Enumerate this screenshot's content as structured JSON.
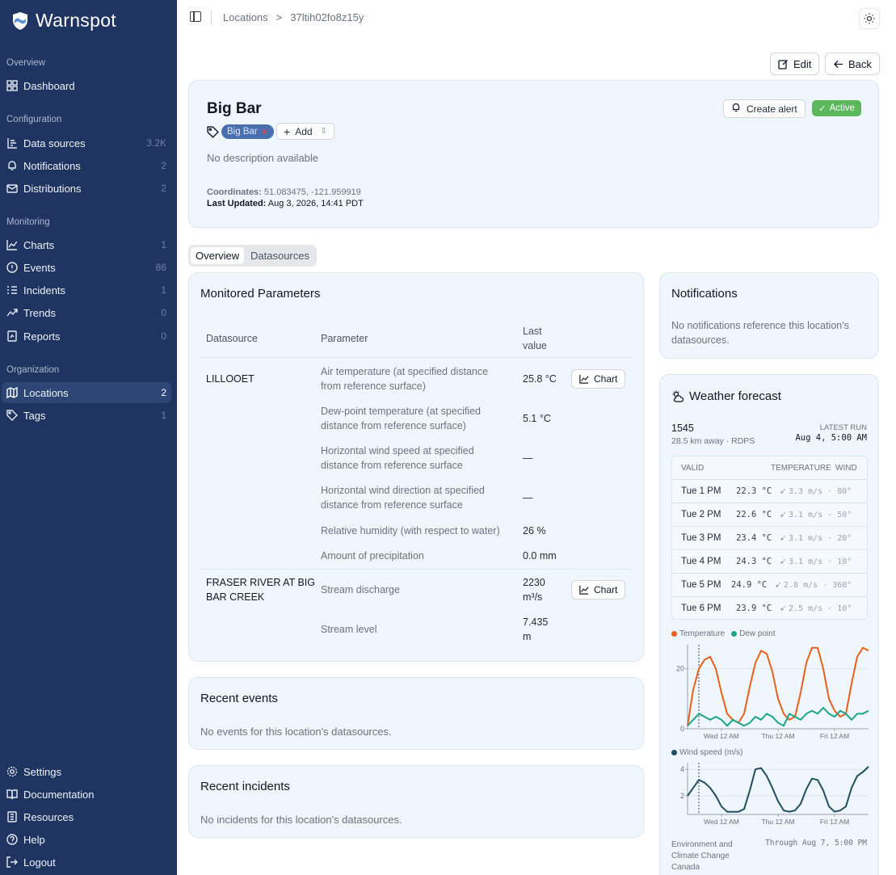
{
  "brand": {
    "name": "Warnspot"
  },
  "sidebar": {
    "sections": [
      {
        "label": "Overview"
      },
      {
        "label": "Configuration"
      },
      {
        "label": "Monitoring"
      },
      {
        "label": "Organization"
      }
    ],
    "items": [
      {
        "label": "Dashboard",
        "count": ""
      },
      {
        "label": "Data sources",
        "count": "3.2K"
      },
      {
        "label": "Notifications",
        "count": "2"
      },
      {
        "label": "Distributions",
        "count": "2"
      },
      {
        "label": "Charts",
        "count": "1"
      },
      {
        "label": "Events",
        "count": "86"
      },
      {
        "label": "Incidents",
        "count": "1"
      },
      {
        "label": "Trends",
        "count": "0"
      },
      {
        "label": "Reports",
        "count": "0"
      },
      {
        "label": "Locations",
        "count": "2"
      },
      {
        "label": "Tags",
        "count": "1"
      }
    ],
    "footer": [
      {
        "label": "Settings"
      },
      {
        "label": "Documentation"
      },
      {
        "label": "Resources"
      },
      {
        "label": "Help"
      },
      {
        "label": "Logout"
      }
    ]
  },
  "breadcrumb": {
    "parent": "Locations",
    "separator": ">",
    "current": "37ltih02fo8z15y"
  },
  "actions": {
    "edit": "Edit",
    "back": "Back"
  },
  "location": {
    "name": "Big Bar",
    "tag": "Big Bar",
    "add_label": "Add",
    "create_alert": "Create alert",
    "status": "Active",
    "description": "No description available",
    "coords_label": "Coordinates:",
    "coords_value": "51.083475, -121.959919",
    "updated_label": "Last Updated:",
    "updated_value": "Aug 3, 2026, 14:41 PDT"
  },
  "tabs": {
    "overview": "Overview",
    "datasources": "Datasources"
  },
  "monitored": {
    "title": "Monitored Parameters",
    "headers": {
      "datasource": "Datasource",
      "parameter": "Parameter",
      "last_value_1": "Last",
      "last_value_2": "value"
    },
    "chart_label": "Chart",
    "rows": [
      {
        "datasource": "LILLOOET",
        "parameter_1": "Air temperature (at specified distance",
        "parameter_2": "from reference surface)",
        "value_1": "25.8 °C",
        "value_2": ""
      },
      {
        "datasource": "",
        "parameter_1": "Dew-point temperature (at specified",
        "parameter_2": "distance from reference surface)",
        "value_1": "5.1 °C",
        "value_2": ""
      },
      {
        "datasource": "",
        "parameter_1": "Horizontal wind speed at specified",
        "parameter_2": "distance from reference surface",
        "value_1": "—",
        "value_2": ""
      },
      {
        "datasource": "",
        "parameter_1": "Horizontal wind direction at specified",
        "parameter_2": "distance from reference surface",
        "value_1": "—",
        "value_2": ""
      },
      {
        "datasource": "",
        "parameter_1": "Relative humidity (with respect to water)",
        "parameter_2": "",
        "value_1": "26 %",
        "value_2": ""
      },
      {
        "datasource": "",
        "parameter_1": "Amount of precipitation",
        "parameter_2": "",
        "value_1": "0.0 mm",
        "value_2": ""
      },
      {
        "datasource": "FRASER RIVER AT BIG",
        "datasource_2": "BAR CREEK",
        "parameter_1": "Stream discharge",
        "parameter_2": "",
        "value_1": "2230",
        "value_2": "m³/s"
      },
      {
        "datasource": "",
        "parameter_1": "Stream level",
        "parameter_2": "",
        "value_1": "7.435",
        "value_2": "m"
      }
    ]
  },
  "recent_events": {
    "title": "Recent events",
    "empty": "No events for this location's datasources."
  },
  "recent_incidents": {
    "title": "Recent incidents",
    "empty": "No incidents for this location's datasources."
  },
  "notifications": {
    "title": "Notifications",
    "empty_1": "No notifications reference this location's",
    "empty_2": "datasources."
  },
  "weather": {
    "title": "Weather forecast",
    "station": "1545",
    "station_meta": "28.5 km away · RDPS",
    "latest_run_label": "LATEST RUN",
    "latest_run": "Aug 4, 5:00 AM",
    "headers": {
      "valid": "VALID",
      "temperature": "TEMPERATURE",
      "wind": "WIND"
    },
    "rows": [
      {
        "valid": "Tue 1 PM",
        "temp": "22.3 °C",
        "wind": "3.3 m/s · 80°"
      },
      {
        "valid": "Tue 2 PM",
        "temp": "22.6 °C",
        "wind": "3.1 m/s · 50°"
      },
      {
        "valid": "Tue 3 PM",
        "temp": "23.4 °C",
        "wind": "3.1 m/s · 20°"
      },
      {
        "valid": "Tue 4 PM",
        "temp": "24.3 °C",
        "wind": "3.1 m/s · 10°"
      },
      {
        "valid": "Tue 5 PM",
        "temp": "24.9 °C",
        "wind": "2.8 m/s · 360°"
      },
      {
        "valid": "Tue 6 PM",
        "temp": "23.9 °C",
        "wind": "2.5 m/s · 10°"
      }
    ],
    "legend_temp": "Temperature",
    "legend_dew": "Dew point",
    "legend_wind": "Wind speed (m/s)",
    "x_ticks": [
      "Wed 12 AM",
      "Thu 12 AM",
      "Fri 12 AM"
    ],
    "source_1": "Environment and",
    "source_2": "Climate Change",
    "source_3": "Canada",
    "through": "Through Aug 7, 5:00 PM",
    "colors": {
      "temperature": "#e8601c",
      "dew_point": "#1aa58a",
      "wind": "#1f4e5f"
    }
  },
  "chart_data": [
    {
      "type": "line",
      "series": [
        {
          "name": "Temperature",
          "values": [
            1,
            13,
            20,
            23,
            24,
            20,
            12,
            5,
            3,
            2,
            5,
            14,
            22,
            26,
            25,
            19,
            10,
            5,
            3,
            4,
            12,
            22,
            27,
            27,
            20,
            10,
            6,
            4,
            5,
            15,
            24,
            27,
            26
          ]
        },
        {
          "name": "Dew point",
          "values": [
            1,
            3,
            5,
            4,
            3,
            4,
            3,
            1,
            3,
            2,
            1,
            2,
            4,
            3,
            5,
            4,
            2,
            1,
            5,
            4,
            3,
            5,
            6,
            5,
            7,
            5,
            4,
            6,
            5,
            3,
            5,
            5,
            6
          ]
        }
      ],
      "yticks": [
        0,
        20
      ],
      "ylim": [
        0,
        28
      ],
      "xticks": [
        "Wed 12 AM",
        "Thu 12 AM",
        "Fri 12 AM"
      ]
    },
    {
      "type": "line",
      "series": [
        {
          "name": "Wind speed (m/s)",
          "values": [
            2.0,
            2.6,
            3.2,
            3.0,
            2.6,
            2.0,
            1.2,
            0.8,
            0.8,
            0.8,
            1.0,
            2.4,
            4.0,
            4.1,
            3.5,
            2.6,
            1.6,
            0.9,
            0.8,
            0.9,
            1.4,
            2.5,
            3.3,
            3.2,
            2.4,
            1.2,
            0.8,
            0.9,
            1.2,
            2.6,
            3.5,
            3.8,
            4.2
          ]
        }
      ],
      "yticks": [
        2,
        4
      ],
      "ylim": [
        0.6,
        4.5
      ],
      "xticks": [
        "Wed 12 AM",
        "Thu 12 AM",
        "Fri 12 AM"
      ]
    }
  ]
}
